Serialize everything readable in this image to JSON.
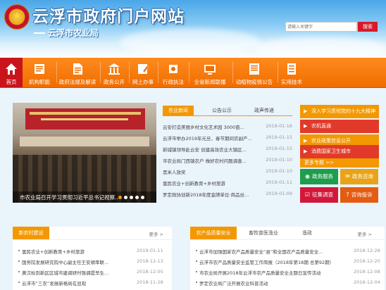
{
  "header": {
    "site_title": "云浮市政府门户网站",
    "subtitle": "云浮市农业局",
    "search_placeholder": "请输入关键字",
    "search_button": "搜索"
  },
  "nav": {
    "items": [
      {
        "label": "首页",
        "icon": "home-icon"
      },
      {
        "label": "机构职能",
        "icon": "book-icon"
      },
      {
        "label": "政府法规及解读",
        "icon": "document-icon"
      },
      {
        "label": "政务公开",
        "icon": "government-icon"
      },
      {
        "label": "网上办事",
        "icon": "edit-icon"
      },
      {
        "label": "行政执法",
        "icon": "gavel-icon"
      },
      {
        "label": "全省新闻联播",
        "icon": "broadcast-icon"
      },
      {
        "label": "动植物疫情公告",
        "icon": "notice-icon"
      },
      {
        "label": "实用技术",
        "icon": "tools-icon"
      }
    ]
  },
  "carousel": {
    "caption": "市农业局召开学习贯彻习近平总书记视察..."
  },
  "news": {
    "tabs": [
      "农业新闻",
      "公告公示",
      "政声传递"
    ],
    "active_tab": 0,
    "items": [
      {
        "title": "云安打造美丽乡村文化艺术园 3000亩...",
        "date": "2019-01-16"
      },
      {
        "title": "云浮市举办2019年元旦、春节期间农副产...",
        "date": "2019-01-15"
      },
      {
        "title": "新城镇领导赴云安 创建高效农业大镇区...",
        "date": "2019-01-15"
      },
      {
        "title": "市农业局门西镇农户 做好农村问题调查...",
        "date": "2019-01-10"
      },
      {
        "title": "黑米人放奖",
        "date": "2019-01-10"
      },
      {
        "title": "富民农业+创新教育+乡村旅游",
        "date": "2019-01-11"
      },
      {
        "title": "罗定政协创新2018年度金牌单位·商品丝...",
        "date": "2019-01-09"
      }
    ]
  },
  "quick_links": {
    "items": [
      {
        "label": "深入学习贯彻党的十九大精神",
        "style": "orange"
      },
      {
        "label": "农机直通",
        "style": "red"
      },
      {
        "label": "农业政策信息公开",
        "style": "orange"
      },
      {
        "label": "消费国家卫生城市",
        "style": "red"
      }
    ],
    "more_label": "更多专题 >>"
  },
  "service_buttons": [
    {
      "label": "政务服务",
      "icon": "globe-icon"
    },
    {
      "label": "政务咨询",
      "icon": "chat-icon"
    },
    {
      "label": "征集调查",
      "icon": "survey-icon"
    },
    {
      "label": "咨询投诉",
      "icon": "question-icon"
    }
  ],
  "section_left": {
    "title": "新农村建设",
    "more": "更多 >",
    "items": [
      {
        "title": "富民农业+创新教育+乡村旅游",
        "date": "2019-01-11"
      },
      {
        "title": "国务院发展研究院中心副主任王安顺率联...",
        "date": "2018-12-13"
      },
      {
        "title": "黄汉标到新区区城市建调研时强调提早生...",
        "date": "2018-12-05"
      },
      {
        "title": "云浮市“三农”发展新格局在显现",
        "date": "2018-11-28"
      }
    ]
  },
  "section_right": {
    "tabs": [
      "农产品质量安全",
      "畜牧兽医渔业",
      "渔政"
    ],
    "active_tab": 0,
    "more": "更多 >",
    "items": [
      {
        "title": "云浮市加强国家农产品质量安全“县”和全国农产品质量安全...",
        "date": "2018-12-28"
      },
      {
        "title": "云浮市农产品质量安全监管工作简报（2018年第18期 总第92期）",
        "date": "2018-12-20"
      },
      {
        "title": "市农业局开展2018年云浮市农产品质量安全主题日宣传活动",
        "date": "2018-12-08"
      },
      {
        "title": "罗定农业局广泛开展农业科普活动",
        "date": "2018-12-04"
      }
    ]
  },
  "colors": {
    "nav_orange": "#f39800",
    "home_red": "#c9141b",
    "search_red": "#d6192b"
  }
}
